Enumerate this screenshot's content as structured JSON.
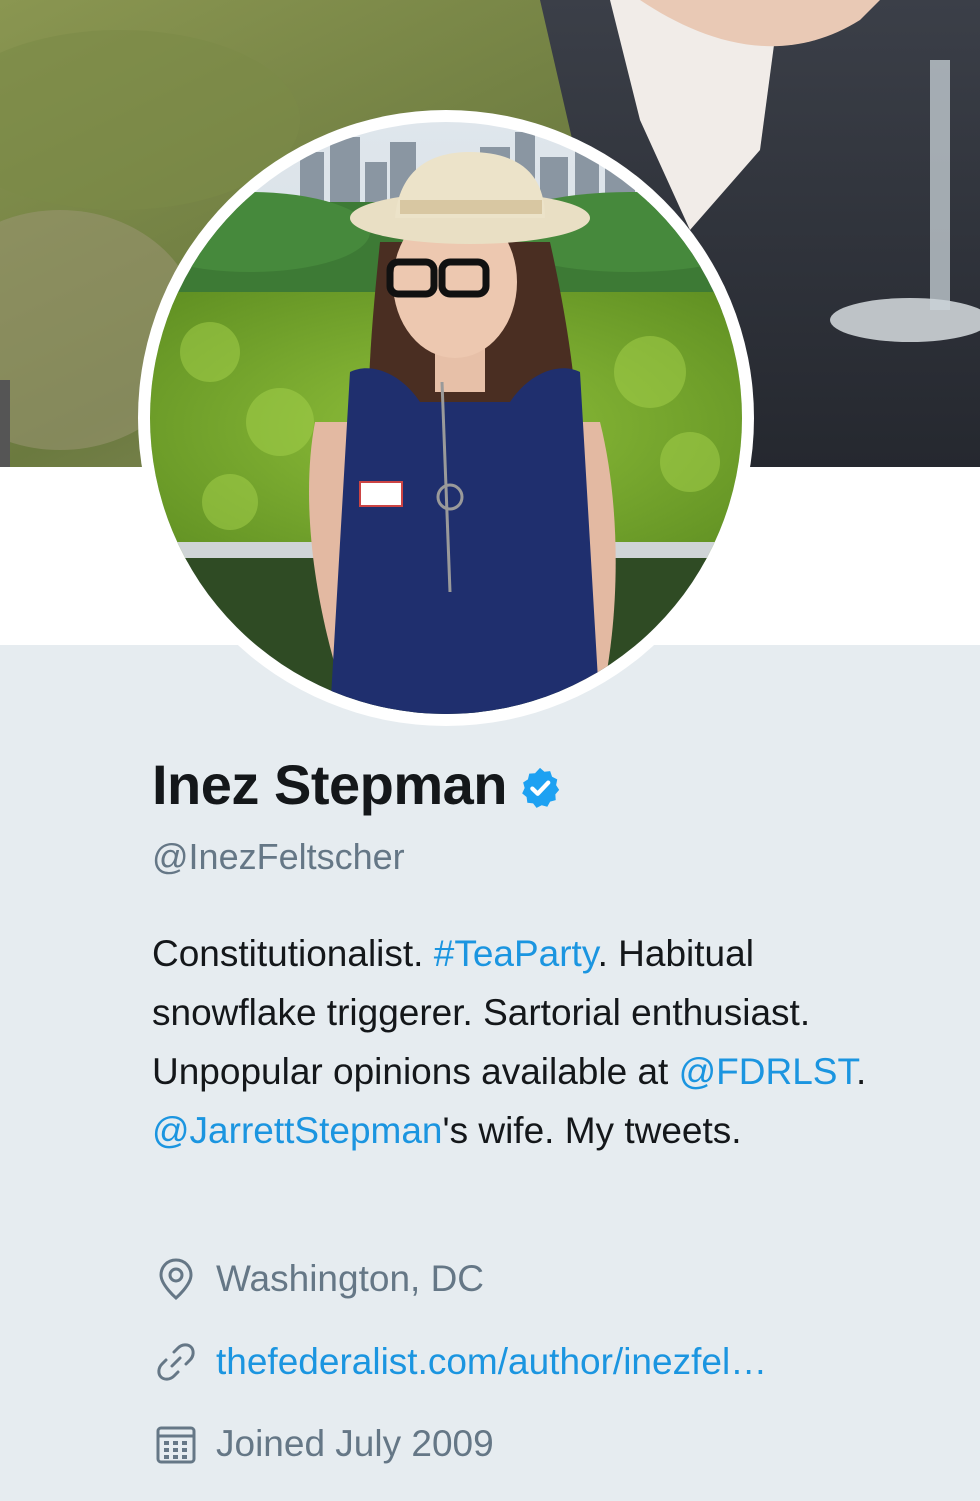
{
  "profile": {
    "name": "Inez Stepman",
    "handle": "@InezFeltscher",
    "verified": true,
    "bio": {
      "part1": "Constitutionalist. ",
      "hashtag": "#TeaParty",
      "part2": ". Habitual snowflake triggerer. Sartorial enthusiast. Unpopular opinions available at ",
      "mention1": "@FDRLST",
      "part3": ". ",
      "mention2": "@JarrettStepman",
      "part4": "'s wife. My tweets."
    },
    "location": "Washington, DC",
    "website": "thefederalist.com/author/inezfel…",
    "joined": "Joined July 2009"
  },
  "colors": {
    "link": "#1b95e0",
    "verified": "#1da1f2",
    "secondary_text": "#657786",
    "primary_text": "#14171a",
    "profile_bg": "#e6ecf0"
  },
  "icons": {
    "verified": "verified-badge-icon",
    "location": "map-pin-icon",
    "website": "link-icon",
    "joined": "calendar-icon"
  }
}
